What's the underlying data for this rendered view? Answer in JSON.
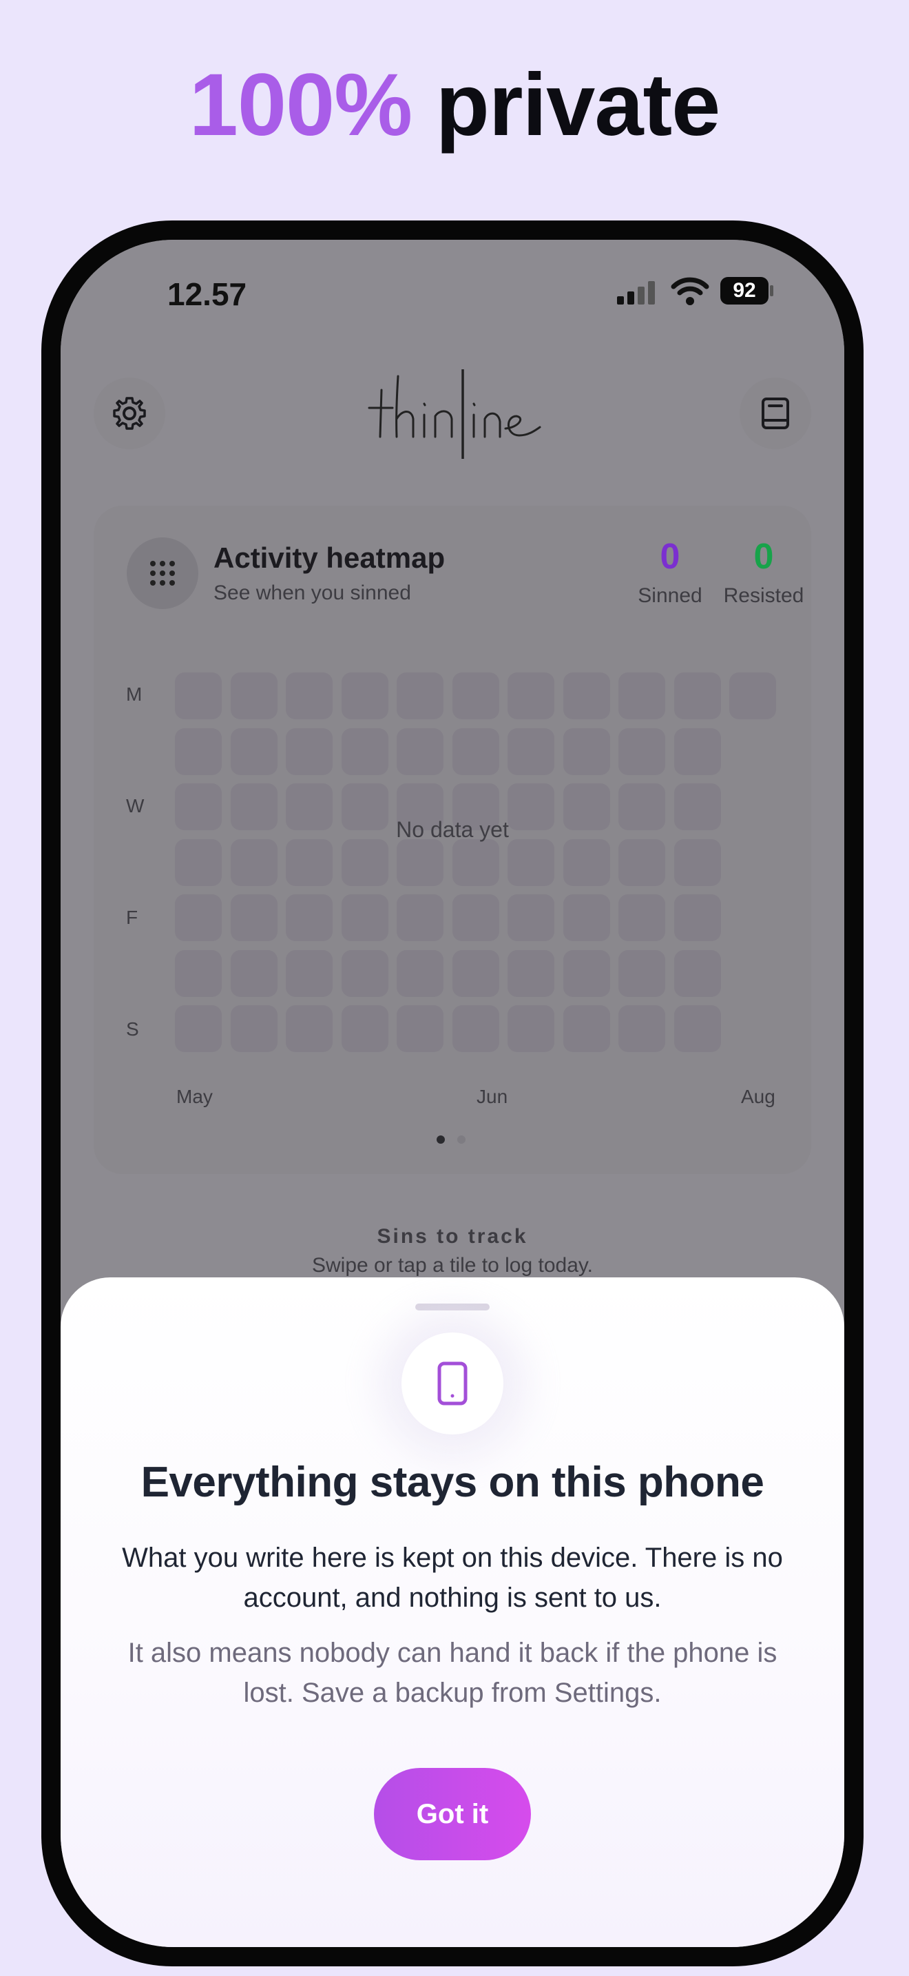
{
  "promo": {
    "headline_accent": "100%",
    "headline_rest": "private"
  },
  "status_bar": {
    "time": "12.57",
    "battery": "92"
  },
  "header": {
    "logo_text": "thinline",
    "settings_icon": "gear-icon",
    "journal_icon": "book-icon"
  },
  "heatmap": {
    "title": "Activity heatmap",
    "subtitle": "See when you sinned",
    "sinned_count": "0",
    "sinned_label": "Sinned",
    "resisted_count": "0",
    "resisted_label": "Resisted",
    "day_labels": [
      "M",
      "W",
      "F",
      "S"
    ],
    "empty_text": "No data yet",
    "months": [
      "May",
      "Jun",
      "Aug"
    ],
    "page_dots_total": 2,
    "page_dots_active": 1
  },
  "sins": {
    "title": "Sins to track",
    "subtitle": "Swipe or tap a tile to log today."
  },
  "sheet": {
    "icon": "phone-icon",
    "title": "Everything stays on this phone",
    "body": "What you write here is kept on this device. There is no account, and nothing is sent to us.",
    "note": "It also means nobody can hand it back if the phone is lost. Save a backup from Settings.",
    "button_label": "Got it"
  },
  "colors": {
    "accent": "#a95de8",
    "sinned": "#7b2fd0",
    "resisted": "#17a34a",
    "button": "#c14fea"
  }
}
